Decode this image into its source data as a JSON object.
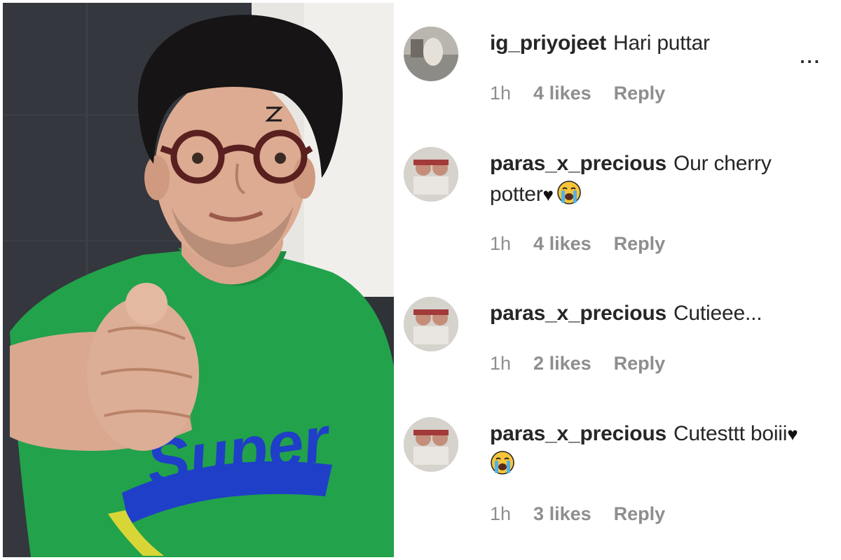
{
  "comments": [
    {
      "username": "ig_priyojeet",
      "text": "Hari puttar",
      "time": "1h",
      "likes": "4 likes",
      "reply": "Reply",
      "more": "..."
    },
    {
      "username": "paras_x_precious",
      "text": "Our cherry potter",
      "heart": "♥",
      "emoji": "crying-face-emoji",
      "time": "1h",
      "likes": "4 likes",
      "reply": "Reply"
    },
    {
      "username": "paras_x_precious",
      "text": "Cutieee...",
      "time": "1h",
      "likes": "2 likes",
      "reply": "Reply"
    },
    {
      "username": "paras_x_precious",
      "text": "Cutesttt boiii",
      "heart": "♥",
      "emoji": "crying-face-emoji",
      "time": "1h",
      "likes": "3 likes",
      "reply": "Reply"
    }
  ],
  "photo": {
    "shirt_text": "Super",
    "shirt_color": "#22a24a",
    "print_color": "#1f3fc8"
  }
}
